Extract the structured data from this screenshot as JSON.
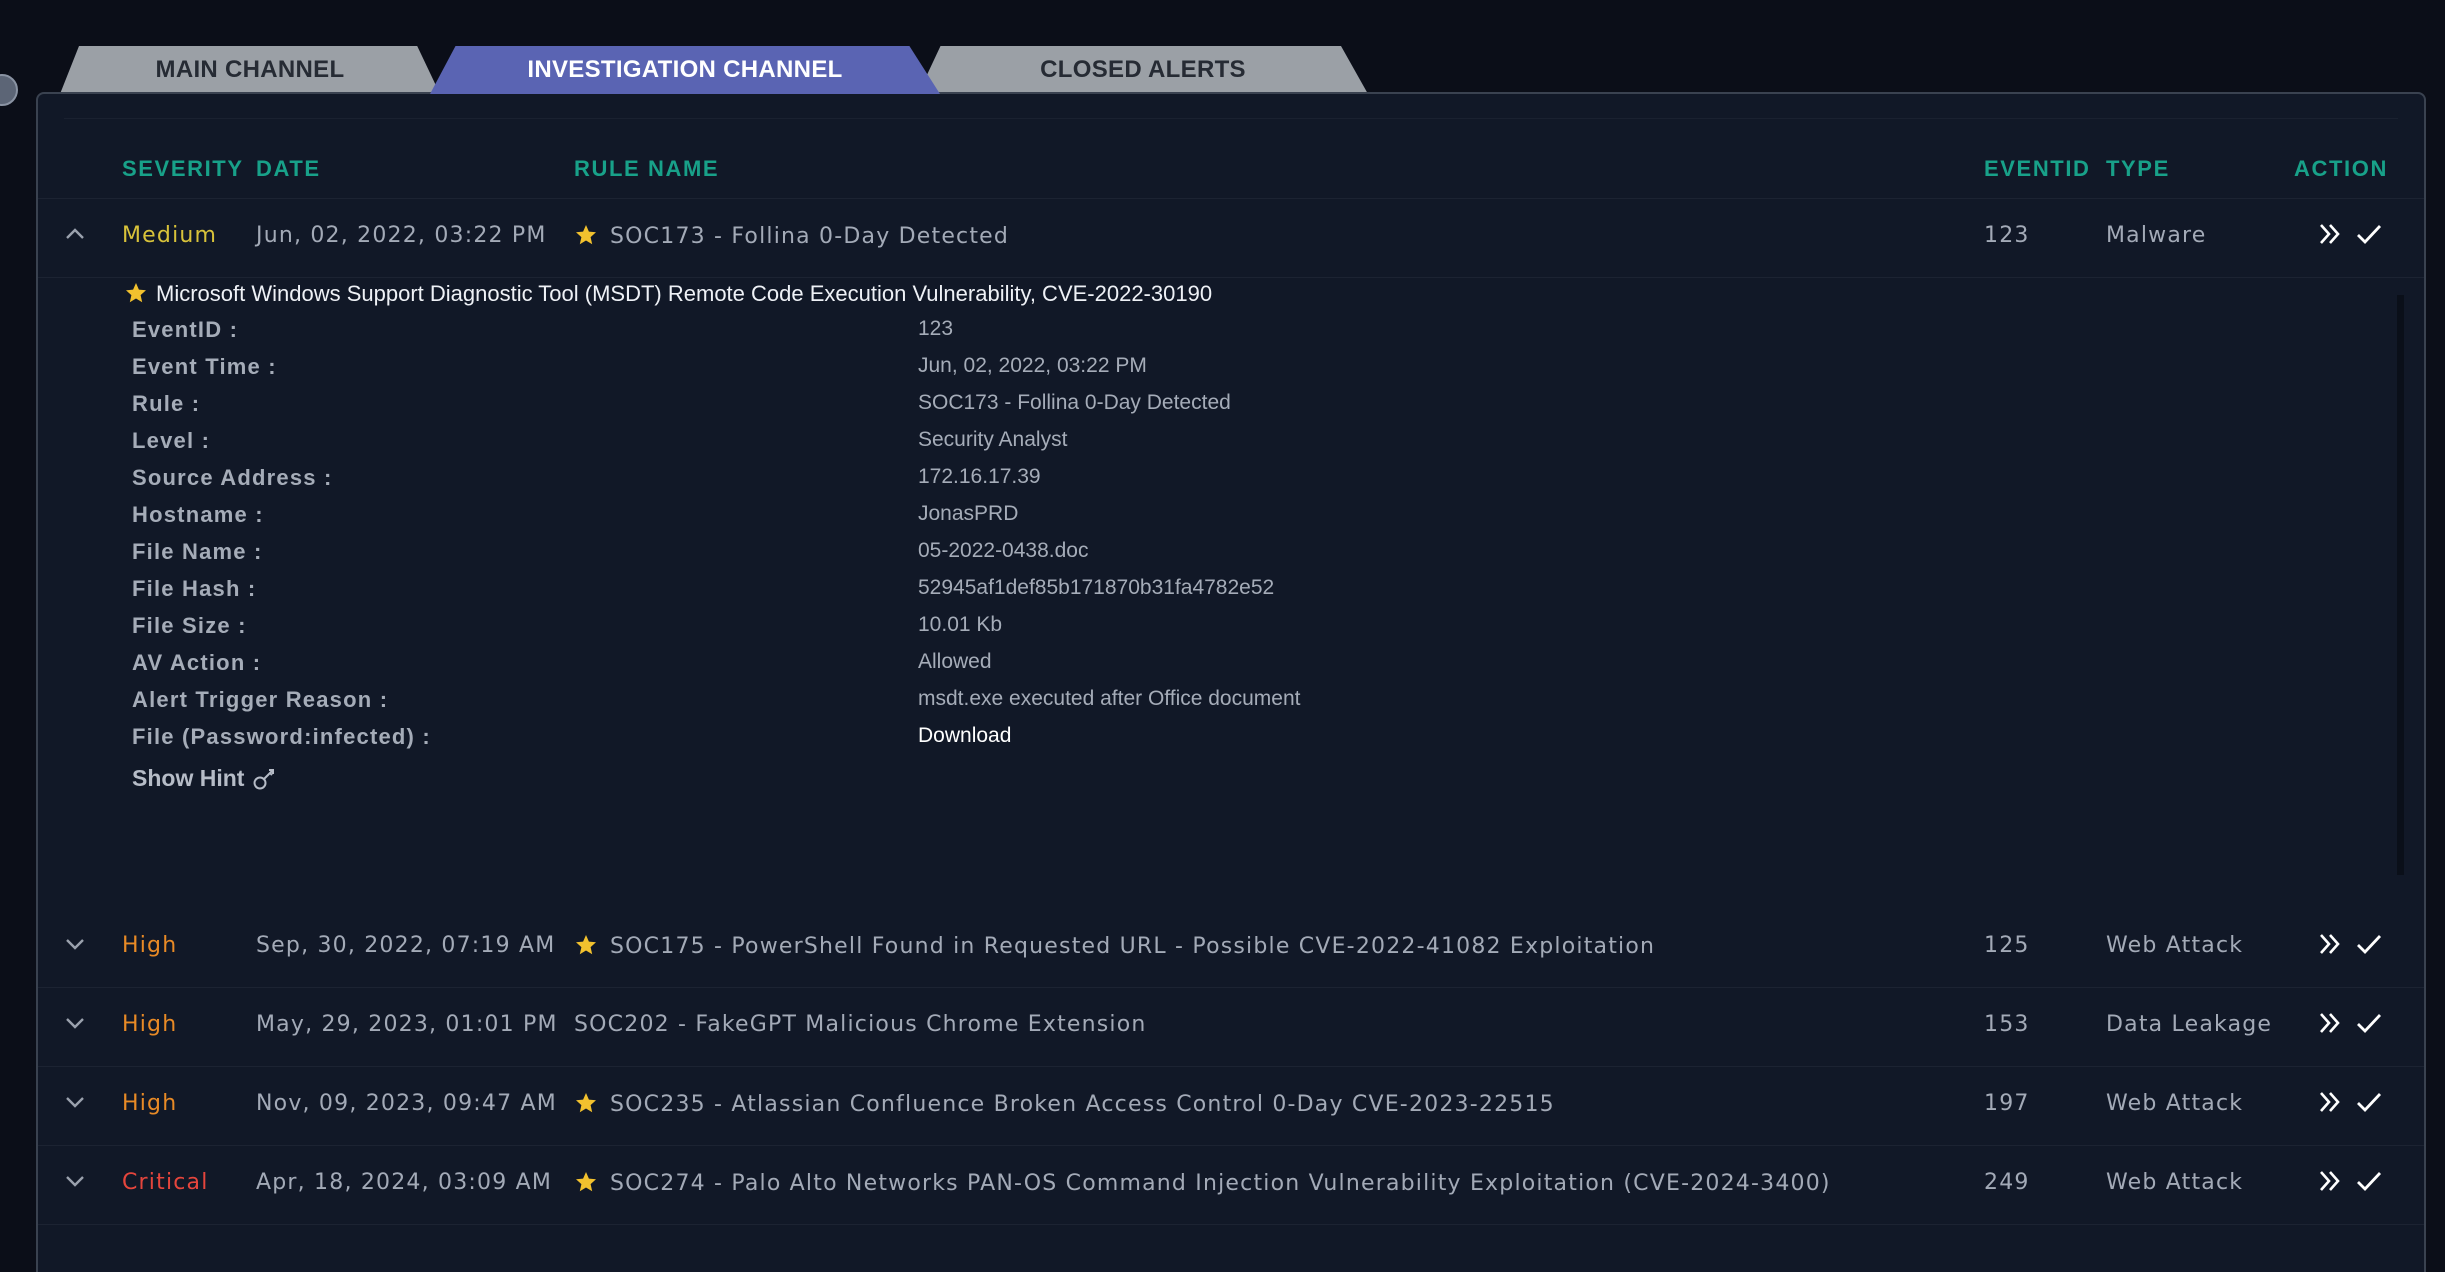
{
  "tabs": [
    {
      "label": "MAIN CHANNEL"
    },
    {
      "label": "INVESTIGATION CHANNEL"
    },
    {
      "label": "CLOSED ALERTS"
    }
  ],
  "columns": {
    "severity": "SEVERITY",
    "date": "DATE",
    "rule": "RULE NAME",
    "eventid": "EVENTID",
    "type": "TYPE",
    "action": "ACTION"
  },
  "alerts": [
    {
      "severity": "Medium",
      "date": "Jun, 02, 2022, 03:22 PM",
      "rule": "SOC173 - Follina 0-Day Detected",
      "eventid": "123",
      "type": "Malware"
    },
    {
      "severity": "High",
      "date": "Sep, 30, 2022, 07:19 AM",
      "rule": "SOC175 - PowerShell Found in Requested URL - Possible CVE-2022-41082 Exploitation",
      "eventid": "125",
      "type": "Web Attack"
    },
    {
      "severity": "High",
      "date": "May, 29, 2023, 01:01 PM",
      "rule": "SOC202 - FakeGPT Malicious Chrome Extension",
      "eventid": "153",
      "type": "Data Leakage"
    },
    {
      "severity": "High",
      "date": "Nov, 09, 2023, 09:47 AM",
      "rule": "SOC235 - Atlassian Confluence Broken Access Control 0-Day CVE-2023-22515",
      "eventid": "197",
      "type": "Web Attack"
    },
    {
      "severity": "Critical",
      "date": "Apr, 18, 2024, 03:09 AM",
      "rule": "SOC274 - Palo Alto Networks PAN-OS Command Injection Vulnerability Exploitation (CVE-2024-3400)",
      "eventid": "249",
      "type": "Web Attack"
    }
  ],
  "detail": {
    "title": "Microsoft Windows Support Diagnostic Tool (MSDT) Remote Code Execution Vulnerability, CVE-2022-30190",
    "fields": [
      {
        "label": "EventID :",
        "value": "123"
      },
      {
        "label": "Event Time :",
        "value": "Jun, 02, 2022, 03:22 PM"
      },
      {
        "label": "Rule :",
        "value": "SOC173 - Follina 0-Day Detected"
      },
      {
        "label": "Level :",
        "value": "Security Analyst"
      },
      {
        "label": "Source Address :",
        "value": "172.16.17.39"
      },
      {
        "label": "Hostname :",
        "value": "JonasPRD"
      },
      {
        "label": "File Name :",
        "value": "05-2022-0438.doc"
      },
      {
        "label": "File Hash :",
        "value": "52945af1def85b171870b31fa4782e52"
      },
      {
        "label": "File Size :",
        "value": "10.01 Kb"
      },
      {
        "label": "AV Action :",
        "value": "Allowed"
      },
      {
        "label": "Alert Trigger Reason :",
        "value": "msdt.exe executed after Office document"
      },
      {
        "label": "File (Password:infected) :",
        "value": "Download"
      }
    ],
    "hint": "Show Hint"
  },
  "icons": {
    "expand": "chevron-down-icon",
    "collapse": "chevron-up-icon",
    "star": "star-icon",
    "escalate": "double-chevron-right-icon",
    "close": "check-icon",
    "hint": "key-icon"
  },
  "colors": {
    "header": "#18a189",
    "medium": "#d8c23a",
    "high": "#e88a26",
    "critical": "#e5453c",
    "active_tab": "#5a64b3",
    "star": "#f2c12e"
  }
}
